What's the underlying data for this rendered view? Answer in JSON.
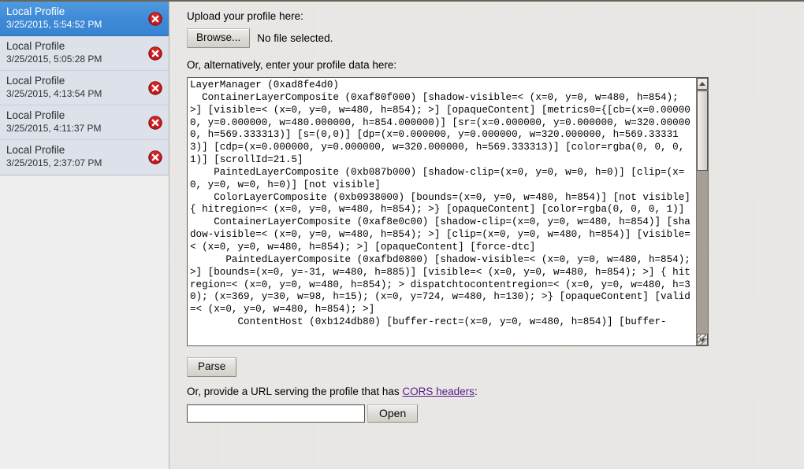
{
  "sidebar": {
    "profiles": [
      {
        "title": "Local Profile",
        "date": "3/25/2015, 5:54:52 PM",
        "selected": true
      },
      {
        "title": "Local Profile",
        "date": "3/25/2015, 5:05:28 PM",
        "selected": false
      },
      {
        "title": "Local Profile",
        "date": "3/25/2015, 4:13:54 PM",
        "selected": false
      },
      {
        "title": "Local Profile",
        "date": "3/25/2015, 4:11:37 PM",
        "selected": false
      },
      {
        "title": "Local Profile",
        "date": "3/25/2015, 2:37:07 PM",
        "selected": false
      }
    ],
    "delete_icon": "delete-circle-icon"
  },
  "main": {
    "upload_label": "Upload your profile here:",
    "browse_label": "Browse...",
    "file_status": "No file selected.",
    "textarea_label": "Or, alternatively, enter your profile data here:",
    "textarea_value": "LayerManager (0xad8fe4d0)\n  ContainerLayerComposite (0xaf80f000) [shadow-visible=< (x=0, y=0, w=480, h=854); >] [visible=< (x=0, y=0, w=480, h=854); >] [opaqueContent] [metrics0={[cb=(x=0.000000, y=0.000000, w=480.000000, h=854.000000)] [sr=(x=0.000000, y=0.000000, w=320.000000, h=569.333313)] [s=(0,0)] [dp=(x=0.000000, y=0.000000, w=320.000000, h=569.333313)] [cdp=(x=0.000000, y=0.000000, w=320.000000, h=569.333313)] [color=rgba(0, 0, 0, 1)] [scrollId=21.5]\n    PaintedLayerComposite (0xb087b000) [shadow-clip=(x=0, y=0, w=0, h=0)] [clip=(x=0, y=0, w=0, h=0)] [not visible]\n    ColorLayerComposite (0xb0938000) [bounds=(x=0, y=0, w=480, h=854)] [not visible] { hitregion=< (x=0, y=0, w=480, h=854); >} [opaqueContent] [color=rgba(0, 0, 0, 1)]\n    ContainerLayerComposite (0xaf8e0c00) [shadow-clip=(x=0, y=0, w=480, h=854)] [shadow-visible=< (x=0, y=0, w=480, h=854); >] [clip=(x=0, y=0, w=480, h=854)] [visible=< (x=0, y=0, w=480, h=854); >] [opaqueContent] [force-dtc]\n      PaintedLayerComposite (0xafbd0800) [shadow-visible=< (x=0, y=0, w=480, h=854); >] [bounds=(x=0, y=-31, w=480, h=885)] [visible=< (x=0, y=0, w=480, h=854); >] { hitregion=< (x=0, y=0, w=480, h=854); > dispatchtocontentregion=< (x=0, y=0, w=480, h=30); (x=369, y=30, w=98, h=15); (x=0, y=724, w=480, h=130); >} [opaqueContent] [valid=< (x=0, y=0, w=480, h=854); >]\n        ContentHost (0xb124db80) [buffer-rect=(x=0, y=0, w=480, h=854)] [buffer-",
    "parse_label": "Parse",
    "url_label_before": "Or, provide a URL serving the profile that has ",
    "url_link_label": "CORS headers",
    "url_label_after": ":",
    "url_value": "",
    "url_placeholder": "",
    "open_label": "Open"
  },
  "colors": {
    "selected_blue": "#3f8ad6",
    "delete_red": "#c3161c",
    "link_purple": "#551a8b",
    "sidebar_bg": "#dce1ea"
  }
}
